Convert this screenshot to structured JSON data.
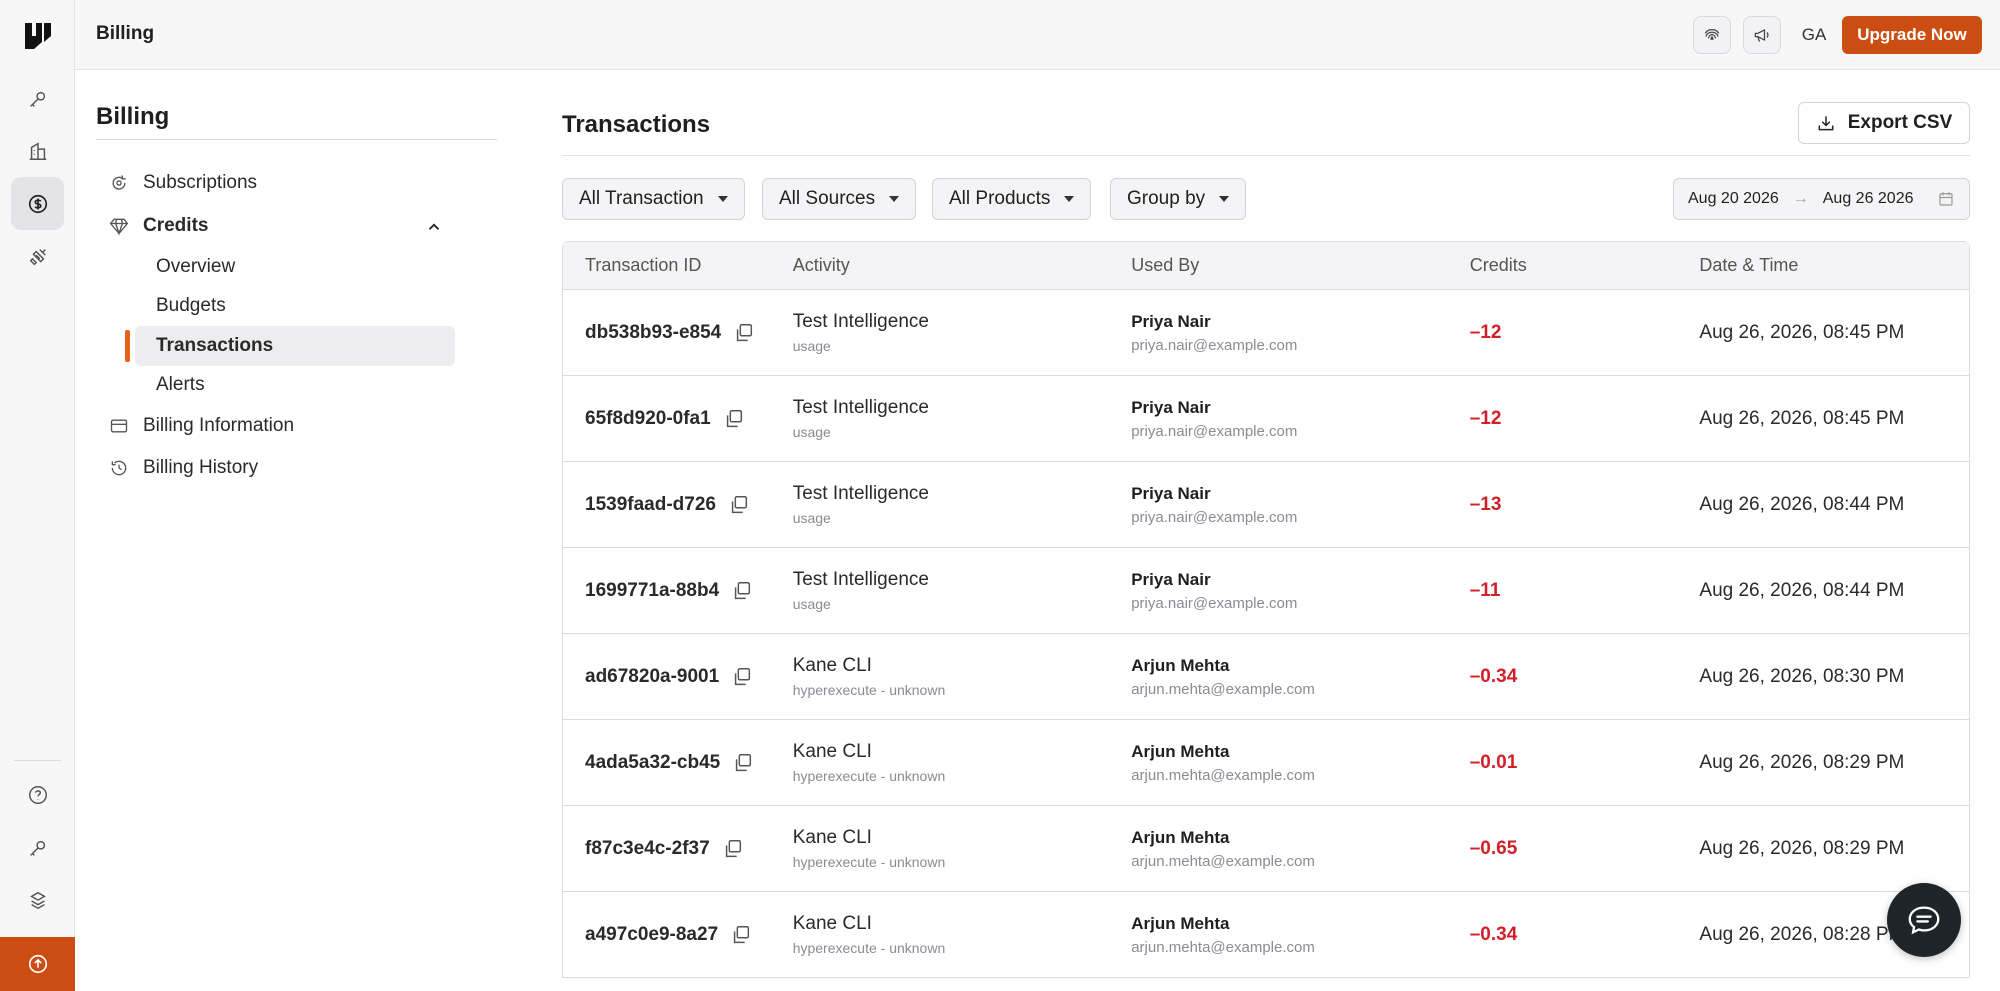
{
  "app": {
    "title": "Billing"
  },
  "rail": {
    "items": [
      "key-icon",
      "building-icon",
      "dollar-icon",
      "plug-icon"
    ],
    "bottom_items": [
      "help-icon",
      "key-icon",
      "stack-icon"
    ],
    "upgrade_icon": "arrow-up-circle-icon"
  },
  "topbar": {
    "avatar_initials": "GA",
    "upgrade_label": "Upgrade Now"
  },
  "sidebar": {
    "heading": "Billing",
    "items": [
      {
        "label": "Subscriptions",
        "icon": "refresh-icon"
      },
      {
        "label": "Credits",
        "icon": "diamond-icon"
      },
      {
        "label": "Billing Information",
        "icon": "card-icon"
      },
      {
        "label": "Billing History",
        "icon": "history-icon"
      }
    ],
    "credits_sub": [
      "Overview",
      "Budgets",
      "Transactions",
      "Alerts"
    ],
    "active_sub": "Transactions"
  },
  "main": {
    "title": "Transactions",
    "export_label": "Export CSV",
    "filters": [
      "All Transaction",
      "All Sources",
      "All Products",
      "Group by"
    ],
    "date_from": "Aug 20 2026",
    "date_to": "Aug 26 2026"
  },
  "table": {
    "columns": [
      "Transaction ID",
      "Activity",
      "Used By",
      "Credits",
      "Date & Time"
    ],
    "rows": [
      {
        "id": "db538b93-e854",
        "activity": "Test Intelligence",
        "activity_sub": "usage",
        "user": "Priya Nair",
        "email": "priya.nair@example.com",
        "credits": "–12",
        "datetime": "Aug 26, 2026, 08:45 PM"
      },
      {
        "id": "65f8d920-0fa1",
        "activity": "Test Intelligence",
        "activity_sub": "usage",
        "user": "Priya Nair",
        "email": "priya.nair@example.com",
        "credits": "–12",
        "datetime": "Aug 26, 2026, 08:45 PM"
      },
      {
        "id": "1539faad-d726",
        "activity": "Test Intelligence",
        "activity_sub": "usage",
        "user": "Priya Nair",
        "email": "priya.nair@example.com",
        "credits": "–13",
        "datetime": "Aug 26, 2026, 08:44 PM"
      },
      {
        "id": "1699771a-88b4",
        "activity": "Test Intelligence",
        "activity_sub": "usage",
        "user": "Priya Nair",
        "email": "priya.nair@example.com",
        "credits": "–11",
        "datetime": "Aug 26, 2026, 08:44 PM"
      },
      {
        "id": "ad67820a-9001",
        "activity": "Kane CLI",
        "activity_sub": "hyperexecute - unknown",
        "user": "Arjun Mehta",
        "email": "arjun.mehta@example.com",
        "credits": "–0.34",
        "datetime": "Aug 26, 2026, 08:30 PM"
      },
      {
        "id": "4ada5a32-cb45",
        "activity": "Kane CLI",
        "activity_sub": "hyperexecute - unknown",
        "user": "Arjun Mehta",
        "email": "arjun.mehta@example.com",
        "credits": "–0.01",
        "datetime": "Aug 26, 2026, 08:29 PM"
      },
      {
        "id": "f87c3e4c-2f37",
        "activity": "Kane CLI",
        "activity_sub": "hyperexecute - unknown",
        "user": "Arjun Mehta",
        "email": "arjun.mehta@example.com",
        "credits": "–0.65",
        "datetime": "Aug 26, 2026, 08:29 PM"
      },
      {
        "id": "a497c0e9-8a27",
        "activity": "Kane CLI",
        "activity_sub": "hyperexecute - unknown",
        "user": "Arjun Mehta",
        "email": "arjun.mehta@example.com",
        "credits": "–0.34",
        "datetime": "Aug 26, 2026, 08:28 PM"
      }
    ]
  },
  "colors": {
    "accent": "#cc4d11",
    "negative": "#d21f2a",
    "chat": "#1f2428"
  }
}
